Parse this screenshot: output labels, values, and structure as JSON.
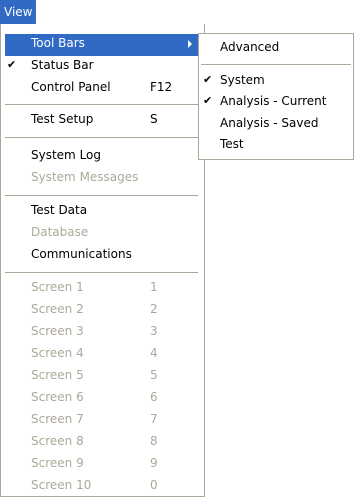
{
  "menubar": {
    "view": "View"
  },
  "menu": {
    "tool_bars": "Tool Bars",
    "status_bar": "Status Bar",
    "control_panel": "Control Panel",
    "control_panel_shortcut": "F12",
    "test_setup": "Test Setup",
    "test_setup_shortcut": "S",
    "system_log": "System Log",
    "system_messages": "System Messages",
    "test_data": "Test Data",
    "database": "Database",
    "communications": "Communications",
    "screens": [
      {
        "label": "Screen 1",
        "shortcut": "1"
      },
      {
        "label": "Screen 2",
        "shortcut": "2"
      },
      {
        "label": "Screen 3",
        "shortcut": "3"
      },
      {
        "label": "Screen 4",
        "shortcut": "4"
      },
      {
        "label": "Screen 5",
        "shortcut": "5"
      },
      {
        "label": "Screen 6",
        "shortcut": "6"
      },
      {
        "label": "Screen 7",
        "shortcut": "7"
      },
      {
        "label": "Screen 8",
        "shortcut": "8"
      },
      {
        "label": "Screen 9",
        "shortcut": "9"
      },
      {
        "label": "Screen 10",
        "shortcut": "0"
      }
    ]
  },
  "submenu": {
    "advanced": "Advanced",
    "system": "System",
    "analysis_current": "Analysis - Current",
    "analysis_saved": "Analysis - Saved",
    "test": "Test"
  },
  "check_glyph": "✔",
  "colors": {
    "highlight": "#316ac5",
    "disabled": "#aca899"
  }
}
